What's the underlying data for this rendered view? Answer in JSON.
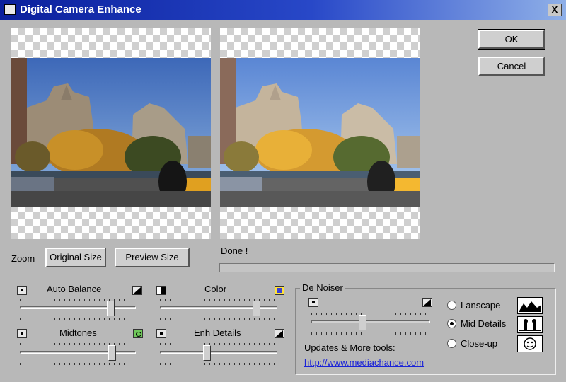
{
  "window": {
    "title": "Digital Camera Enhance",
    "close_label": "X"
  },
  "buttons": {
    "ok": "OK",
    "cancel": "Cancel",
    "original_size": "Original Size",
    "preview_size": "Preview Size"
  },
  "zoom": {
    "label": "Zoom"
  },
  "status": {
    "text": "Done !",
    "progress": 0
  },
  "adjustments": {
    "auto_balance": {
      "label": "Auto Balance",
      "value": 0.78,
      "left_icon": "dot-icon",
      "right_icon": "contrast-icon"
    },
    "color": {
      "label": "Color",
      "value": 0.82,
      "left_icon": "bw-icon",
      "right_icon": "color-icon"
    },
    "midtones": {
      "label": "Midtones",
      "value": 0.79,
      "left_icon": "dark-icon",
      "right_icon": "bright-icon"
    },
    "enh_details": {
      "label": "Enh Details",
      "value": 0.4,
      "left_icon": "dot-icon",
      "right_icon": "detail-icon"
    }
  },
  "denoiser": {
    "label": "De Noiser",
    "slider_value": 0.43,
    "options": [
      {
        "label": "Lanscape",
        "selected": false,
        "icon": "landscape-icon"
      },
      {
        "label": "Mid Details",
        "selected": true,
        "icon": "people-icon"
      },
      {
        "label": "Close-up",
        "selected": false,
        "icon": "face-icon"
      }
    ],
    "updates_label": "Updates & More tools:",
    "link": "http://www.mediachance.com"
  }
}
